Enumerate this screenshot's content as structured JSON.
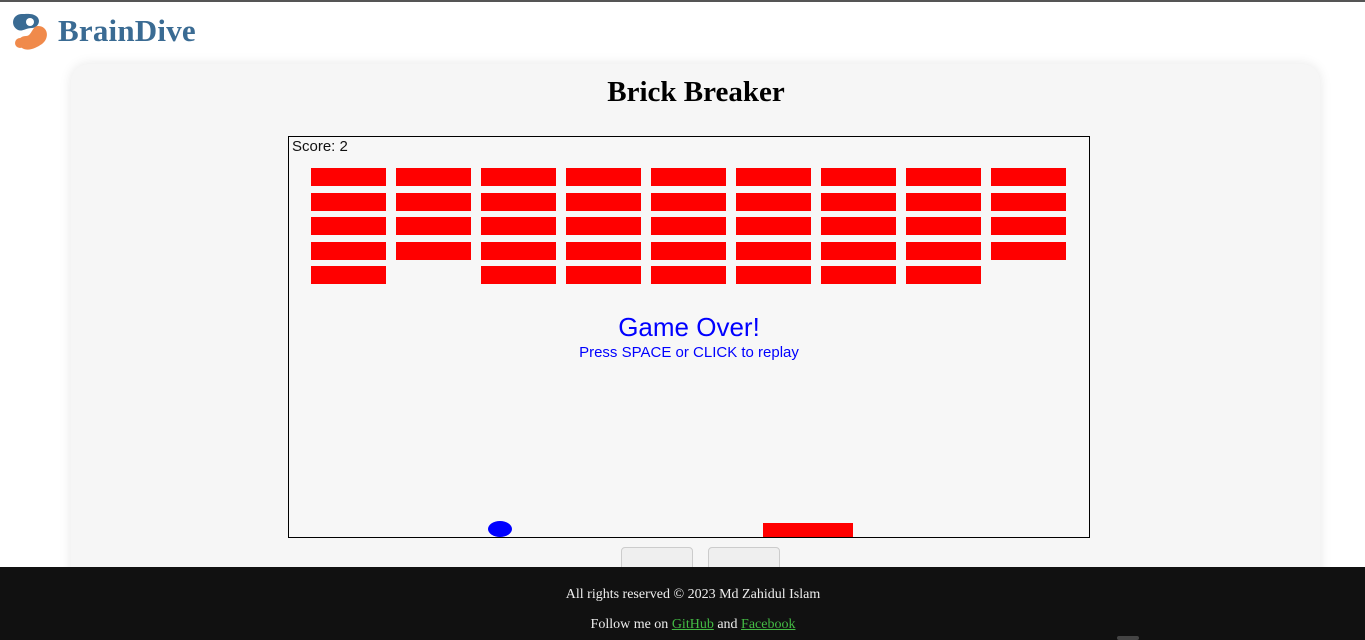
{
  "header": {
    "brand": "BrainDive",
    "logo_icon": "braindive-logo-icon"
  },
  "game": {
    "title": "Brick Breaker",
    "score_text": "Score: 2",
    "game_over_title": "Game Over!",
    "game_over_subtitle": "Press SPACE or CLICK to replay",
    "brick_color": "#ff0000",
    "ball_color": "#0000ff",
    "paddle_color": "#ff0000",
    "overlay_text_color": "#0000ff",
    "brick_grid": [
      [
        1,
        1,
        1,
        1,
        1,
        1,
        1,
        1,
        1
      ],
      [
        1,
        1,
        1,
        1,
        1,
        1,
        1,
        1,
        1
      ],
      [
        1,
        1,
        1,
        1,
        1,
        1,
        1,
        1,
        1
      ],
      [
        1,
        1,
        1,
        1,
        1,
        1,
        1,
        1,
        1
      ],
      [
        1,
        0,
        1,
        1,
        1,
        1,
        1,
        1,
        0
      ]
    ]
  },
  "controls": {
    "buttons": [
      "",
      ""
    ]
  },
  "footer": {
    "copyright": "All rights reserved © 2023 Md Zahidul Islam",
    "follow_prefix": "Follow me on ",
    "github_label": "GitHub",
    "and_text": " and ",
    "facebook_label": "Facebook"
  }
}
